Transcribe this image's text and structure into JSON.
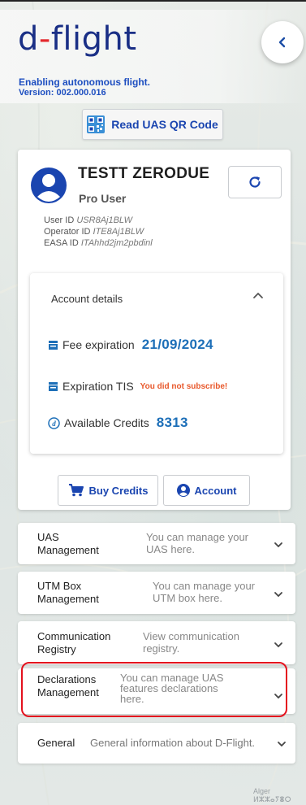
{
  "app": {
    "logo_prefix": "d",
    "logo_dash": "-",
    "logo_suffix": "flight",
    "tagline": "Enabling autonomous flight.",
    "version": "Version: 002.000.016"
  },
  "qr_button": {
    "label": "Read UAS QR Code"
  },
  "user": {
    "name": "TESTT ZERODUE",
    "role": "Pro User",
    "user_id_label": "User ID",
    "user_id": "USR8Aj1BLW",
    "operator_id_label": "Operator ID",
    "operator_id": "ITE8Aj1BLW",
    "easa_id_label": "EASA ID",
    "easa_id": "ITAhhd2jm2pbdinl"
  },
  "account_details": {
    "title": "Account details",
    "fee_expiration_label": "Fee expiration",
    "fee_expiration_value": "21/09/2024",
    "expiration_tis_label": "Expiration TIS",
    "expiration_tis_value": "You did not subscribe!",
    "credits_label": "Available Credits",
    "credits_value": "8313"
  },
  "actions": {
    "buy_credits": "Buy Credits",
    "account": "Account"
  },
  "sections": [
    {
      "title_line1": "UAS",
      "title_line2": "Management",
      "desc_line1": "You can manage your",
      "desc_line2": "UAS here.",
      "desc_line3": ""
    },
    {
      "title_line1": "UTM Box",
      "title_line2": "Management",
      "desc_line1": "You can manage your",
      "desc_line2": "UTM box here.",
      "desc_line3": ""
    },
    {
      "title_line1": "Communication",
      "title_line2": "Registry",
      "desc_line1": "View communication",
      "desc_line2": "registry.",
      "desc_line3": ""
    },
    {
      "title_line1": "Declarations",
      "title_line2": "Management",
      "desc_line1": "You can manage UAS",
      "desc_line2": "features declarations",
      "desc_line3": "here."
    },
    {
      "title_line1": "General",
      "title_line2": "",
      "desc_line1": "General information about D-Flight.",
      "desc_line2": "",
      "desc_line3": ""
    }
  ],
  "map": {
    "label_1": "Alger ⵍⵣⵣⴰⵢⴻⵔ"
  },
  "colors": {
    "brand_blue": "#1a2f86",
    "link_blue": "#1a45b0",
    "value_blue": "#1d6fb8",
    "warning": "#e8572a",
    "highlight": "#e4121e"
  }
}
